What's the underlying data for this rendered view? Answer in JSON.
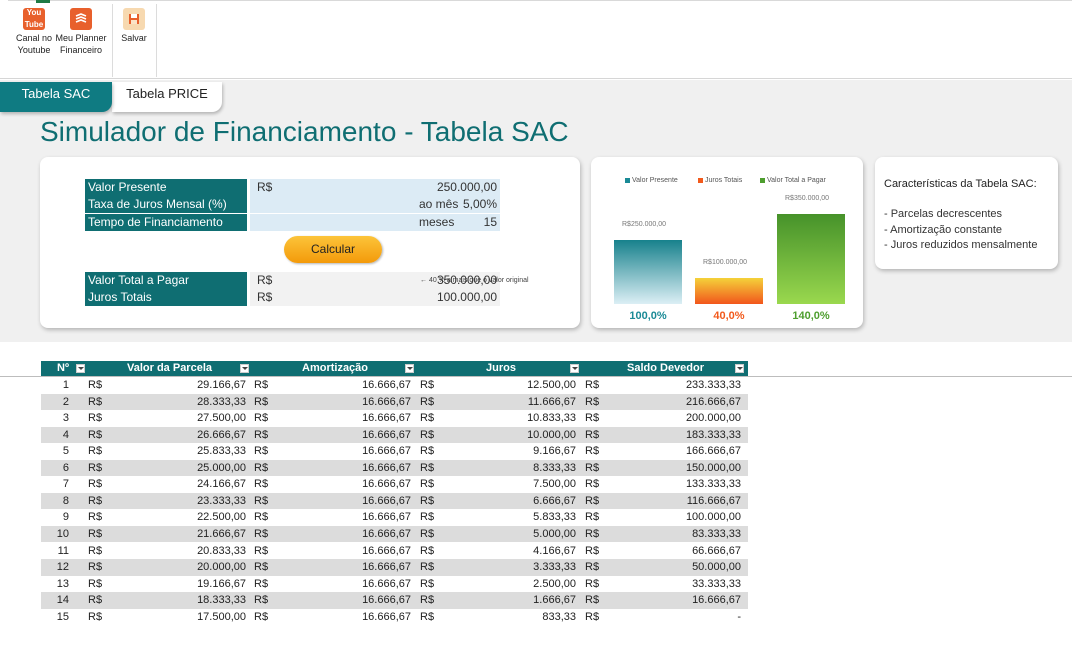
{
  "ribbon": {
    "buttons": [
      {
        "label1": "Canal no",
        "label2": "Youtube",
        "icon": "youtube-icon",
        "color": "#e8602c"
      },
      {
        "label1": "Meu Planner",
        "label2": "Financeiro",
        "icon": "planner-icon",
        "color": "#e8602c"
      },
      {
        "label1": "Salvar",
        "label2": "",
        "icon": "save-icon",
        "color": "#e8602c"
      }
    ]
  },
  "tabs": [
    {
      "label": "Tabela SAC",
      "active": true
    },
    {
      "label": "Tabela PRICE",
      "active": false
    }
  ],
  "title": "Simulador de Financiamento - Tabela SAC",
  "form": {
    "valor_presente": {
      "label": "Valor Presente",
      "currency": "R$",
      "value": "250.000,00"
    },
    "taxa": {
      "label": "Taxa de Juros Mensal (%)",
      "value": "5,00%",
      "suffix": "ao mês"
    },
    "tempo": {
      "label": "Tempo de Financiamento",
      "value": "15",
      "suffix": "meses"
    },
    "calcular": "Calcular",
    "valor_total": {
      "label": "Valor Total a Pagar",
      "currency": "R$",
      "value": "350.000,00"
    },
    "juros_totais": {
      "label": "Juros Totais",
      "currency": "R$",
      "value": "100.000,00"
    },
    "note": "← 40 % a mais que o valor original"
  },
  "chart_data": {
    "type": "bar",
    "categories": [
      "Valor Presente",
      "Juros Totais",
      "Valor Total a Pagar"
    ],
    "values": [
      250000,
      100000,
      350000
    ],
    "data_labels": [
      "R$250.000,00",
      "R$100.000,00",
      "R$350.000,00"
    ],
    "percent_labels": [
      "100,0%",
      "40,0%",
      "140,0%"
    ],
    "colors": [
      "#1a8a96",
      "#f25a1c",
      "#4e9e2e"
    ],
    "legend": "top",
    "ylim": [
      0,
      350000
    ],
    "grid": false
  },
  "characteristics": {
    "title": "Características da Tabela SAC:",
    "items": [
      "- Parcelas decrescentes",
      "- Amortização constante",
      "- Juros reduzidos mensalmente"
    ]
  },
  "table": {
    "headers": [
      "Nº",
      "Valor da Parcela",
      "Amortização",
      "Juros",
      "Saldo Devedor"
    ],
    "currency": "R$",
    "rows": [
      [
        "1",
        "29.166,67",
        "16.666,67",
        "12.500,00",
        "233.333,33"
      ],
      [
        "2",
        "28.333,33",
        "16.666,67",
        "11.666,67",
        "216.666,67"
      ],
      [
        "3",
        "27.500,00",
        "16.666,67",
        "10.833,33",
        "200.000,00"
      ],
      [
        "4",
        "26.666,67",
        "16.666,67",
        "10.000,00",
        "183.333,33"
      ],
      [
        "5",
        "25.833,33",
        "16.666,67",
        "9.166,67",
        "166.666,67"
      ],
      [
        "6",
        "25.000,00",
        "16.666,67",
        "8.333,33",
        "150.000,00"
      ],
      [
        "7",
        "24.166,67",
        "16.666,67",
        "7.500,00",
        "133.333,33"
      ],
      [
        "8",
        "23.333,33",
        "16.666,67",
        "6.666,67",
        "116.666,67"
      ],
      [
        "9",
        "22.500,00",
        "16.666,67",
        "5.833,33",
        "100.000,00"
      ],
      [
        "10",
        "21.666,67",
        "16.666,67",
        "5.000,00",
        "83.333,33"
      ],
      [
        "11",
        "20.833,33",
        "16.666,67",
        "4.166,67",
        "66.666,67"
      ],
      [
        "12",
        "20.000,00",
        "16.666,67",
        "3.333,33",
        "50.000,00"
      ],
      [
        "13",
        "19.166,67",
        "16.666,67",
        "2.500,00",
        "33.333,33"
      ],
      [
        "14",
        "18.333,33",
        "16.666,67",
        "1.666,67",
        "16.666,67"
      ],
      [
        "15",
        "17.500,00",
        "16.666,67",
        "833,33",
        "-"
      ]
    ]
  }
}
